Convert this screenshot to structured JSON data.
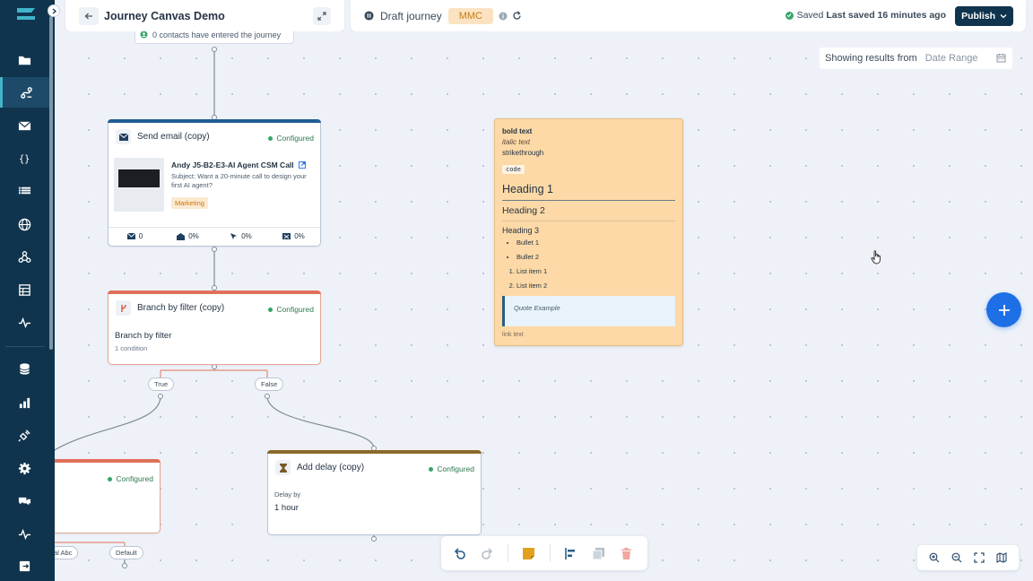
{
  "header": {
    "journey_title": "Journey Canvas Demo",
    "status": "Draft journey",
    "tag": "MMC",
    "saved_label": "Saved",
    "saved_time": "Last saved 16 minutes ago",
    "publish_label": "Publish"
  },
  "results": {
    "label": "Showing results from",
    "date_range": "Date Range"
  },
  "canvas": {
    "entry_chip": "0 contacts have entered the journey",
    "email_node": {
      "title": "Send email (copy)",
      "status": "Configured",
      "email_name": "Andy J5-B2-E3-AI Agent CSM Call",
      "subject": "Subject: Want a 20-minute call to design your first AI agent?",
      "tag": "Marketing",
      "stats": [
        "0",
        "0%",
        "0%",
        "0%"
      ]
    },
    "branch_node": {
      "title": "Branch by filter (copy)",
      "status": "Configured",
      "name": "Branch by filter",
      "sub": "1 condition"
    },
    "branch_pills": {
      "true": "True",
      "false": "False"
    },
    "left_node": {
      "status": "Configured"
    },
    "left_pills": {
      "a": "al Abc",
      "b": "Default"
    },
    "delay_node": {
      "title": "Add delay (copy)",
      "status": "Configured",
      "label": "Delay by",
      "value": "1 hour"
    },
    "sticky": {
      "bold": "bold text",
      "italic": "italic text",
      "strike": "strikethrough",
      "code": "code",
      "h1": "Heading 1",
      "h2": "Heading 2",
      "h3": "Heading 3",
      "bullets": [
        "Bullet 1",
        "Bullet 2"
      ],
      "ordered": [
        "List item 1",
        "List item 2"
      ],
      "quote": "Quote Example",
      "link": "link text"
    }
  },
  "colors": {
    "nav_bg": "#10344d",
    "accent_blue": "#1e6fe6",
    "email_bar": "#1f5d94",
    "branch_bar": "#e0705a",
    "delay_bar": "#8a6a2a",
    "sticky_bg": "#fcd9a6",
    "configured": "#36a56a"
  },
  "icons": {
    "nav": [
      "folder-icon",
      "journey-icon",
      "mail-icon",
      "braces-icon",
      "list-icon",
      "globe-icon",
      "webhook-icon",
      "table-icon",
      "activity-icon",
      "database-icon",
      "bar-chart-icon",
      "plug-icon",
      "gear-icon",
      "chat-icon",
      "pulse-icon",
      "logout-icon"
    ]
  }
}
